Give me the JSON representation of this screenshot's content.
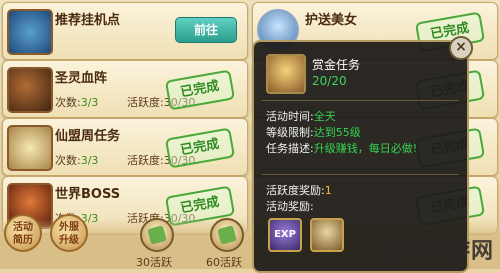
{
  "tasks_left": [
    {
      "title": "推荐挂机点",
      "button": "前往"
    },
    {
      "title": "圣灵血阵",
      "count_label": "次数:",
      "count": "3/3",
      "activity_label": "活跃度:",
      "activity": "30/30",
      "status": "已完成"
    },
    {
      "title": "仙盟周任务",
      "count_label": "次数:",
      "count": "3/3",
      "activity_label": "活跃度:",
      "activity": "30/30",
      "status": "已完成"
    },
    {
      "title": "世界BOSS",
      "count_label": "次数:",
      "count": "3/3",
      "activity_label": "活跃度:",
      "activity": "30/30",
      "status": "已完成"
    }
  ],
  "tasks_right": [
    {
      "title": "护送美女",
      "status": "已完成"
    },
    {
      "status": "已完成"
    },
    {
      "status": "已完成"
    },
    {
      "status": "已完成"
    }
  ],
  "popup": {
    "title": "赏金任务",
    "progress": "20/20",
    "time_label": "活动时间:",
    "time_value": "全天",
    "level_label": "等级限制:",
    "level_value": "达到55级",
    "desc_label": "任务描述:",
    "desc_value": "升级赚钱，每日必做!",
    "activity_reward_label": "活跃度奖励:",
    "activity_reward_value": "1",
    "rewards_label": "活动奖励:",
    "reward_items": [
      "EXP",
      "item"
    ]
  },
  "bottom": {
    "btn1": "活动\n简历",
    "btn2": "外服\n升级",
    "milestone1": "30活跃",
    "milestone2": "60活跃"
  },
  "watermark": "京华手游网"
}
